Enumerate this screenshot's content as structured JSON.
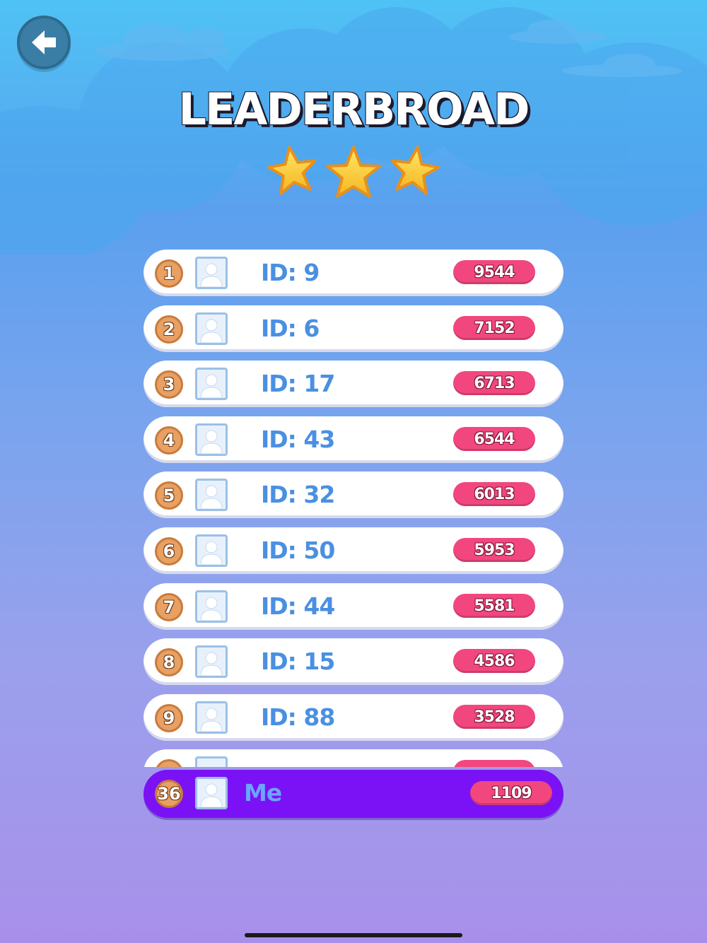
{
  "header": {
    "title": "LEADERBROAD",
    "back_icon": "arrow-left-icon",
    "star_icon": "star-icon",
    "stars_count": 3
  },
  "leaderboard": {
    "rows": [
      {
        "rank": "1",
        "name": "ID: 9",
        "score": "9544"
      },
      {
        "rank": "2",
        "name": "ID: 6",
        "score": "7152"
      },
      {
        "rank": "3",
        "name": "ID: 17",
        "score": "6713"
      },
      {
        "rank": "4",
        "name": "ID: 43",
        "score": "6544"
      },
      {
        "rank": "5",
        "name": "ID: 32",
        "score": "6013"
      },
      {
        "rank": "6",
        "name": "ID: 50",
        "score": "5953"
      },
      {
        "rank": "7",
        "name": "ID: 44",
        "score": "5581"
      },
      {
        "rank": "8",
        "name": "ID: 15",
        "score": "4586"
      },
      {
        "rank": "9",
        "name": "ID: 88",
        "score": "3528"
      }
    ],
    "avatar_icon": "user-avatar-icon"
  },
  "me": {
    "rank": "36",
    "name": "Me",
    "score": "1109"
  },
  "colors": {
    "score_pill": "#f2477e",
    "rank_badge": "#e8a063",
    "me_row": "#7a12f5",
    "name_text": "#4a90e2"
  }
}
